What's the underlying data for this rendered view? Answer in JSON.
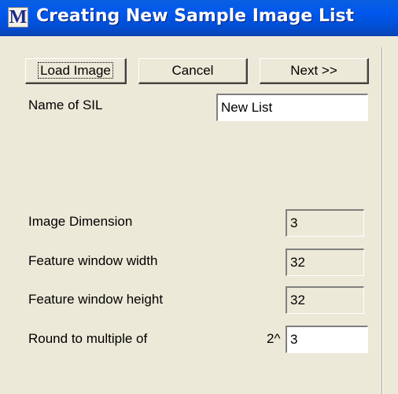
{
  "window": {
    "title": "Creating New Sample Image List",
    "icon": "M"
  },
  "toolbar": {
    "load_label": "Load Image",
    "cancel_label": "Cancel",
    "next_label": "Next >>"
  },
  "form": {
    "name_label": "Name of SIL",
    "name_value": "New List",
    "dimension_label": "Image Dimension",
    "dimension_value": "3",
    "width_label": "Feature window width",
    "width_value": "32",
    "height_label": "Feature window height",
    "height_value": "32",
    "round_label": "Round to multiple of",
    "round_prefix": "2^",
    "round_value": "3"
  }
}
